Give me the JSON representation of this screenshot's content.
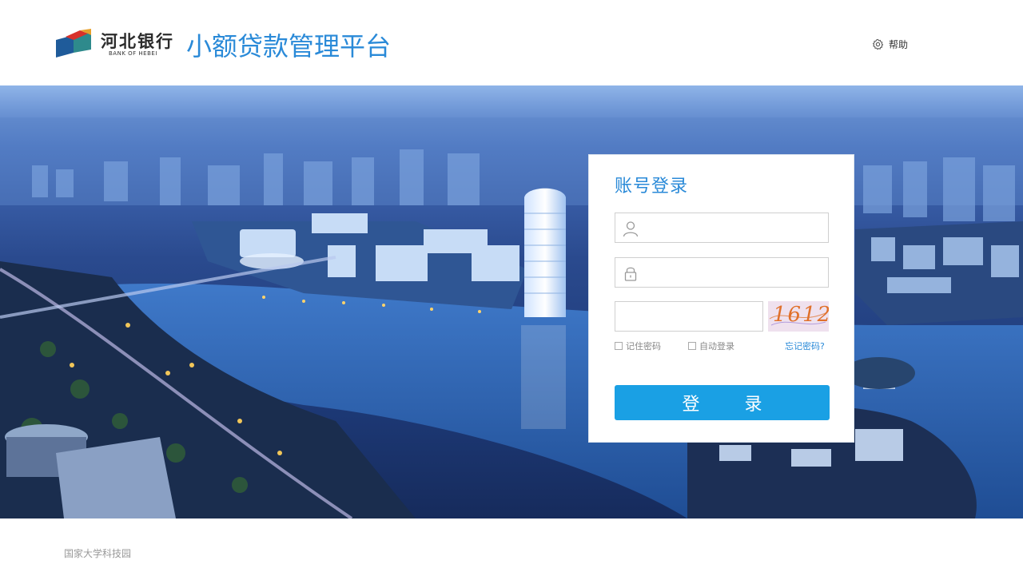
{
  "header": {
    "logo_cn": "河北银行",
    "logo_en": "BANK OF HEBEI",
    "platform_title": "小额贷款管理平台",
    "help_label": "帮助"
  },
  "login": {
    "title": "账号登录",
    "username": {
      "icon": "user-icon",
      "placeholder": "",
      "value": ""
    },
    "password": {
      "icon": "lock-icon",
      "placeholder": "",
      "value": ""
    },
    "captcha": {
      "placeholder": "",
      "value": "",
      "image_text": "1612"
    },
    "remember_label": "记住密码",
    "auto_login_label": "自动登录",
    "forgot_label": "忘记密码?",
    "submit_label": "登录"
  },
  "footer": {
    "caption": "国家大学科技园"
  },
  "colors": {
    "accent": "#2a8ad8",
    "button": "#1aa0e4",
    "captcha_bg": "#efe1ee",
    "captcha_text": "#e0702a"
  }
}
